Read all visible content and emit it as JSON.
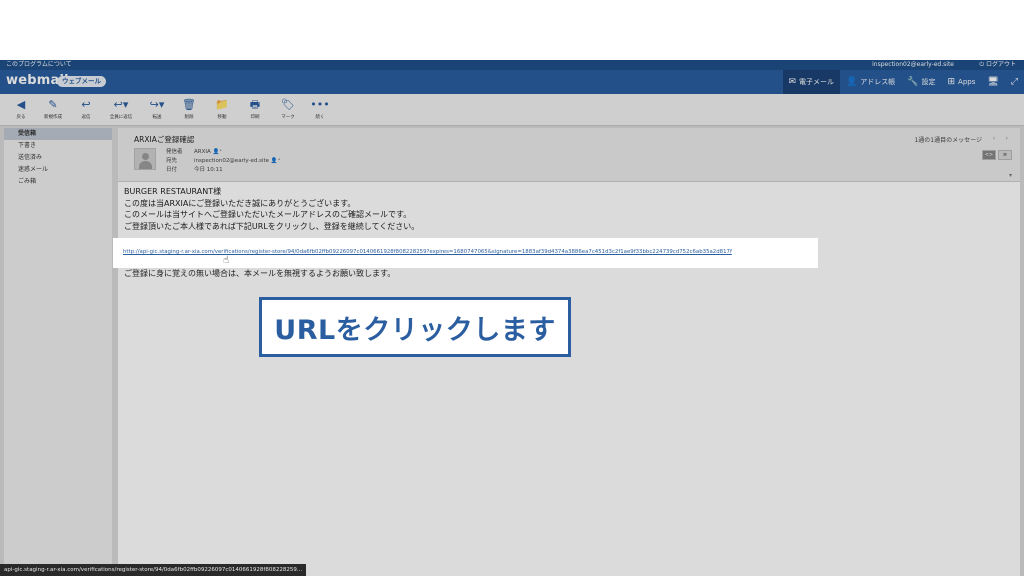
{
  "infobar": {
    "about": "このプログラムについて",
    "user": "inspection02@early-ed.site",
    "logout": "ログアウト"
  },
  "header": {
    "logo": "webmail",
    "badge": "ウェブメール",
    "nav": [
      {
        "label": "電子メール",
        "icon": "envelope-icon"
      },
      {
        "label": "アドレス帳",
        "icon": "person-icon"
      },
      {
        "label": "設定",
        "icon": "wrench-icon"
      },
      {
        "label": "Apps",
        "icon": "plus-square-icon"
      }
    ]
  },
  "toolbar": [
    {
      "label": "戻る",
      "icon": "back-arrow-icon"
    },
    {
      "label": "新規作成",
      "icon": "pencil-icon"
    },
    {
      "label": "返信",
      "icon": "reply-icon"
    },
    {
      "label": "全員に返信",
      "icon": "reply-all-icon"
    },
    {
      "label": "転送",
      "icon": "forward-icon"
    },
    {
      "label": "削除",
      "icon": "trash-icon"
    },
    {
      "label": "移動",
      "icon": "folder-icon"
    },
    {
      "label": "印刷",
      "icon": "printer-icon"
    },
    {
      "label": "マーク",
      "icon": "tag-icon"
    },
    {
      "label": "続く",
      "icon": "more-dots-icon"
    }
  ],
  "sidebar": {
    "folders": [
      "受信箱",
      "下書き",
      "送信済み",
      "迷惑メール",
      "ごみ箱"
    ],
    "active": "受信箱"
  },
  "message": {
    "subject": "ARXIAご登録確認",
    "from_label": "発信者",
    "from": "ARXIA",
    "to_label": "宛先",
    "to": "inspection02@early-ed.site",
    "date_label": "日付",
    "date": "今日 10:11",
    "pager": "1通の1通目のメッセージ",
    "body_lines": [
      "BURGER RESTAURANT様",
      "この度は当ARXIAにご登録いただき誠にありがとうございます。",
      "このメールは当サイトへご登録いただいたメールアドレスのご確認メールです。",
      "ご登録頂いたご本人様であれば下記URLをクリックし、登録を継続してください。"
    ],
    "link": "http://api-gic.staging-r.ar-xia.com/verifications/register-store/94/0da6fb02ffb09226097c0140661928f808228259?expires=1680747065&signature=1883af39d4374a3886ea7c451d3c2f1ae9f33bbc224739cd752c6ab35a2d817f",
    "footer_line": "ご登録に身に覚えの無い場合は、本メールを無視するようお願い致します。"
  },
  "caption": "URLをクリックします",
  "statusbar": "api-gic.staging-r.ar-xia.com/verifications/register-store/94/0da6fb02ffb09226097c0140661928f808228259..."
}
